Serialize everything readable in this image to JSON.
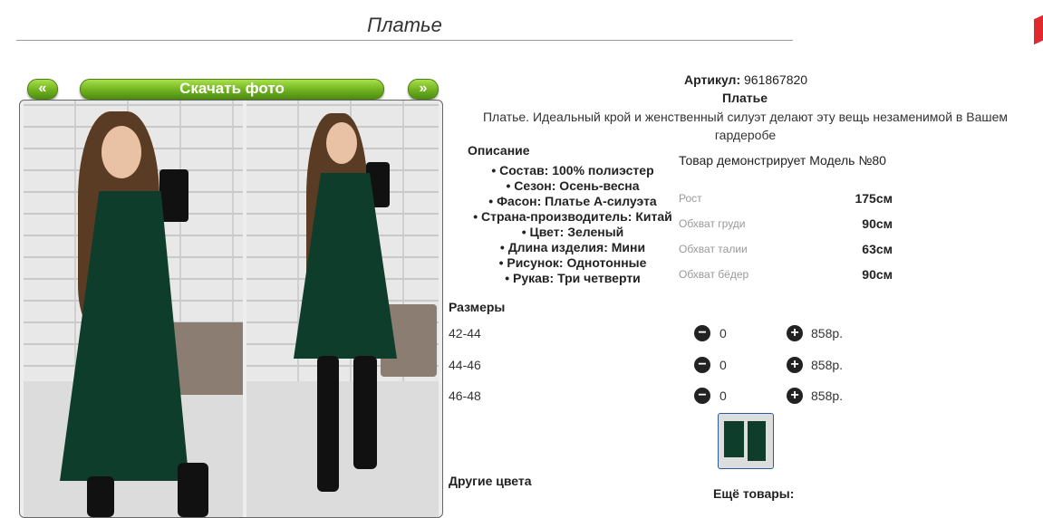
{
  "page": {
    "title": "Платье"
  },
  "gallery": {
    "prev_label": "«",
    "next_label": "»",
    "download_label": "Скачать фото"
  },
  "product": {
    "sku_label": "Артикул:",
    "sku_value": "961867820",
    "name": "Платье",
    "tagline": "Платье. Идеальный крой и женственный силуэт делают эту вещь незаменимой в Вашем гардеробе"
  },
  "description": {
    "heading": "Описание",
    "items": [
      "Состав: 100% полиэстер",
      "Сезон: Осень-весна",
      "Фасон: Платье А-силуэта",
      "Страна-производитель: Китай",
      "Цвет: Зеленый",
      "Длина изделия: Мини",
      "Рисунок: Однотонные",
      "Рукав: Три четверти"
    ]
  },
  "model": {
    "note": "Товар демонстрирует Модель №80",
    "measurements": [
      {
        "label": "Рост",
        "value": "175см"
      },
      {
        "label": "Обхват груди",
        "value": "90см"
      },
      {
        "label": "Обхват талии",
        "value": "63см"
      },
      {
        "label": "Обхват бёдер",
        "value": "90см"
      }
    ]
  },
  "sizes": {
    "heading": "Размеры",
    "rows": [
      {
        "size": "42-44",
        "qty": "0",
        "price": "858р."
      },
      {
        "size": "44-46",
        "qty": "0",
        "price": "858р."
      },
      {
        "size": "46-48",
        "qty": "0",
        "price": "858р."
      }
    ],
    "minus_symbol": "−",
    "plus_symbol": "+"
  },
  "footer": {
    "other_colors": "Другие цвета",
    "more_goods": "Ещё товары:"
  },
  "colors": {
    "button_green": "#6fb21e",
    "dress_green": "#0f3d2b",
    "accent_red": "#e0282f"
  }
}
